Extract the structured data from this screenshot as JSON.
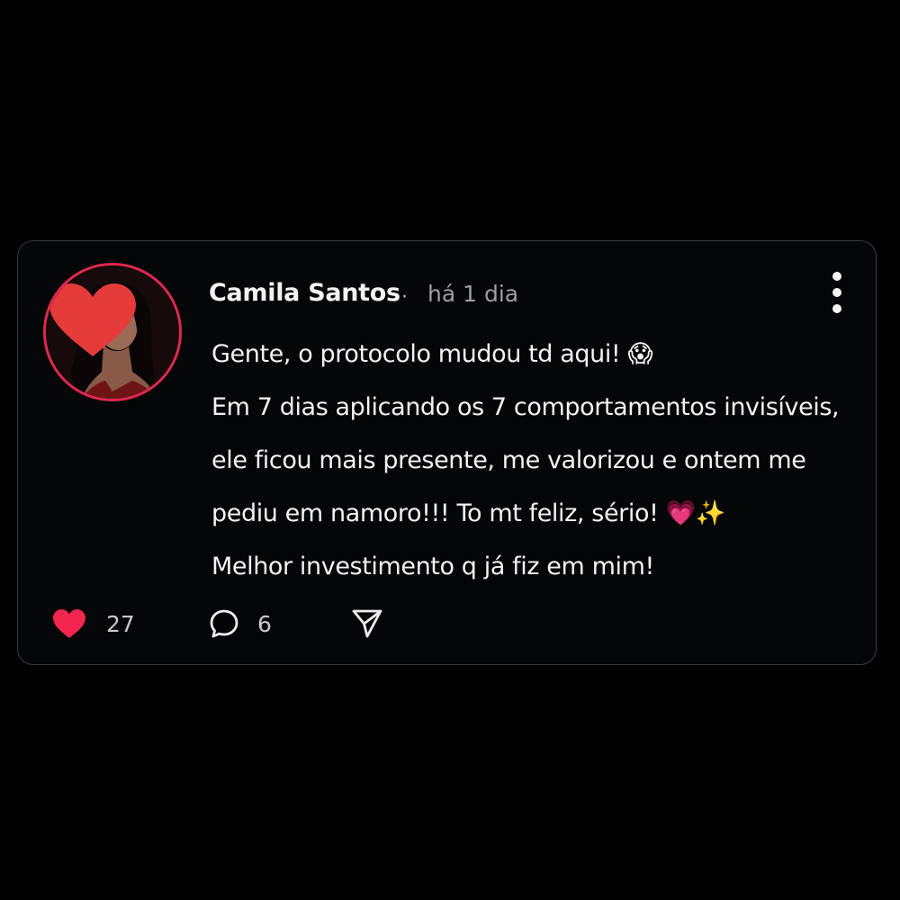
{
  "post": {
    "author_name": "Camila Santos",
    "separator": "·",
    "timestamp": "há 1 dia",
    "text_lines": [
      "Gente, o protocolo mudou td aqui! 😱",
      "Em 7 dias aplicando os 7 comportamentos invisíveis,",
      "ele ficou mais presente, me valorizou e ontem me",
      "pediu em namoro!!! To mt feliz, sério! 💗✨",
      "Melhor investimento q já fiz em mim!"
    ],
    "likes_count": "27",
    "comments_count": "6"
  },
  "icons": {
    "avatar_overlay": "heart-icon",
    "more": "more-vertical-icon",
    "like": "heart-filled-icon",
    "comment": "speech-bubble-icon",
    "share": "paper-plane-icon"
  },
  "colors": {
    "background": "#000000",
    "card_background": "#050608",
    "card_border": "#3a3a3c",
    "avatar_ring": "#e0284f",
    "like_red": "#f4254f",
    "heart_overlay": "#e53b3b",
    "text_primary": "#f2f2f2",
    "text_muted": "#9e9e9e"
  }
}
